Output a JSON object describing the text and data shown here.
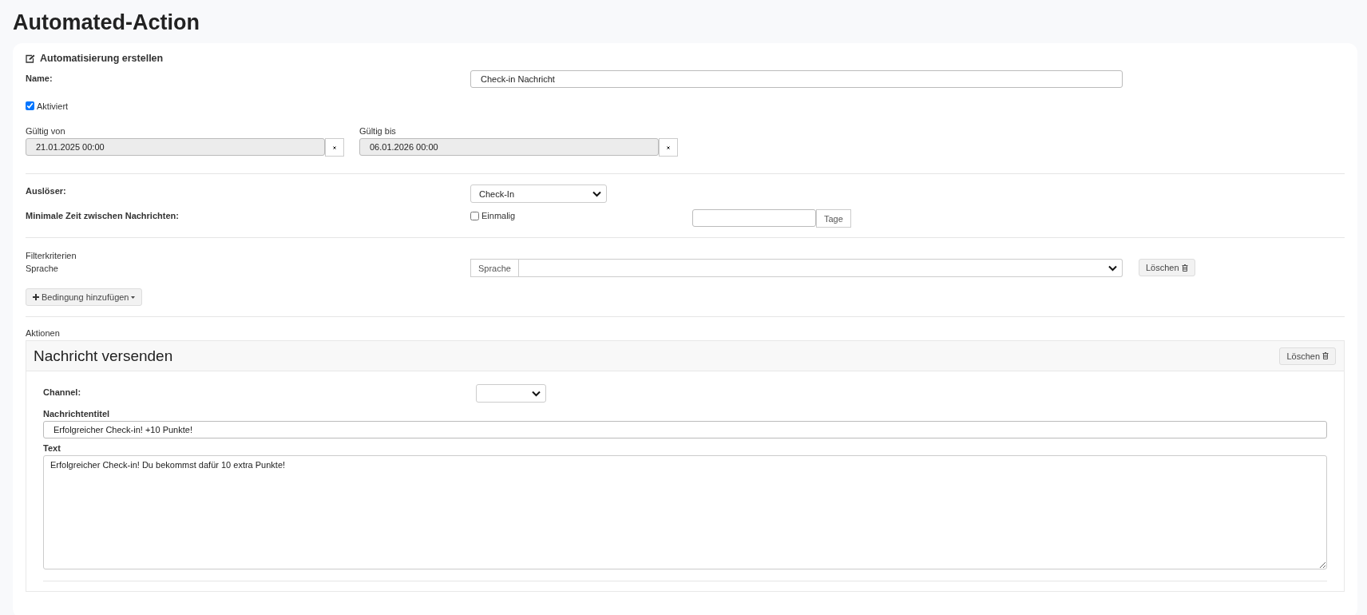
{
  "page_title": "Automated-Action",
  "card": {
    "title": "Automatisierung erstellen"
  },
  "name": {
    "label": "Name:",
    "value": "Check-in Nachricht"
  },
  "activated": {
    "label": "Aktiviert",
    "checked": true
  },
  "validity": [
    {
      "label": "Gültig von",
      "value": "21.01.2025 00:00"
    },
    {
      "label": "Gültig bis",
      "value": "06.01.2026 00:00"
    }
  ],
  "trigger": {
    "label": "Auslöser:",
    "value": "Check-In"
  },
  "min_time": {
    "label": "Minimale Zeit zwischen Nachrichten:",
    "once_label": "Einmalig",
    "once_checked": false,
    "unit": "Tage"
  },
  "filters": {
    "title": "Filterkriterien",
    "items": [
      {
        "label": "Sprache",
        "addon": "Sprache",
        "delete_button": "Löschen"
      }
    ],
    "add_button": "Bedingung hinzufügen"
  },
  "actions": {
    "title": "Aktionen",
    "items": [
      {
        "title": "Nachricht versenden",
        "delete_button": "Löschen",
        "channel_label": "Channel:",
        "subject_label": "Nachrichtentitel",
        "subject": "Erfolgreicher Check-in! +10 Punkte!",
        "text_label": "Text",
        "text": "Erfolgreicher Check-in! Du bekommst dafür 10 extra Punkte!"
      }
    ]
  }
}
